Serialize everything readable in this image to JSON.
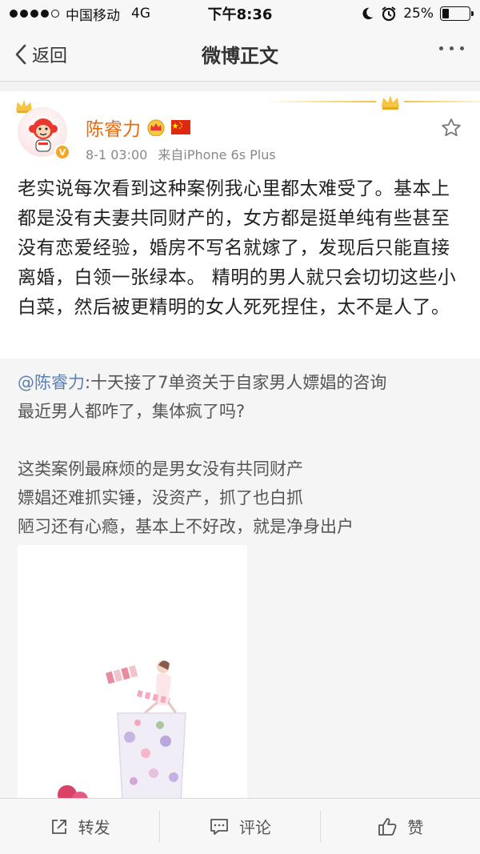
{
  "status_bar": {
    "carrier": "中国移动",
    "network": "4G",
    "time": "下午8:36",
    "battery_percent": "25%",
    "battery_level": 0.25
  },
  "nav": {
    "back_label": "返回",
    "title": "微博正文"
  },
  "post": {
    "username": "陈睿力",
    "timestamp": "8-1 03:00",
    "source": "来自iPhone 6s Plus",
    "text": "老实说每次看到这种案例我心里都太难受了。基本上都是没有夫妻共同财产的，女方都是挺单纯有些甚至没有恋爱经验，婚房不写名就嫁了，发现后只能直接离婚，白领一张绿本。 精明的男人就只会切切这些小白菜，然后被更精明的女人死死捏住，太不是人了。"
  },
  "repost": {
    "mention": "@陈睿力",
    "text_line1": ":十天接了7单资关于自家男人嫖娼的咨询",
    "text_line2": "最近男人都咋了，集体疯了吗?",
    "text_line3": "这类案例最麻烦的是男女没有共同财产",
    "text_line4": "嫖娼还难抓实锤，没资产，抓了也白抓",
    "text_line5": "陋习还有心瘾，基本上不好改，就是净身出户"
  },
  "toolbar": {
    "repost_label": "转发",
    "comment_label": "评论",
    "like_label": "赞"
  },
  "colors": {
    "username": "#e86b10",
    "mention": "#5d7fb3",
    "crown": "#f5c440"
  }
}
